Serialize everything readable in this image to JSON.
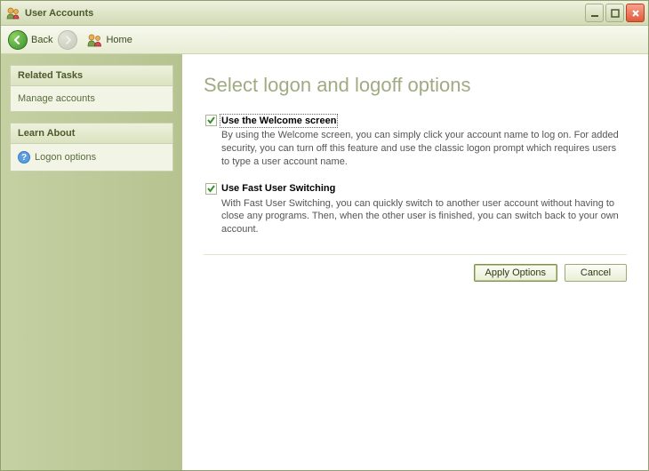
{
  "window": {
    "title": "User Accounts"
  },
  "nav": {
    "back": "Back",
    "home": "Home"
  },
  "sidebar": {
    "related_tasks": {
      "header": "Related Tasks",
      "items": [
        {
          "label": "Manage accounts"
        }
      ]
    },
    "learn_about": {
      "header": "Learn About",
      "items": [
        {
          "label": "Logon options"
        }
      ]
    }
  },
  "content": {
    "title": "Select logon and logoff options",
    "options": [
      {
        "label": "Use the Welcome screen",
        "checked": true,
        "focused": true,
        "description": "By using the Welcome screen, you can simply click your account name to log on. For added security, you can turn off this feature and use the classic logon prompt which requires users to type a user account name."
      },
      {
        "label": "Use Fast User Switching",
        "checked": true,
        "focused": false,
        "description": "With Fast User Switching, you can quickly switch to another user account without having to close any programs. Then, when the other user is finished, you can switch back to your own account."
      }
    ],
    "buttons": {
      "apply": "Apply Options",
      "cancel": "Cancel"
    }
  }
}
